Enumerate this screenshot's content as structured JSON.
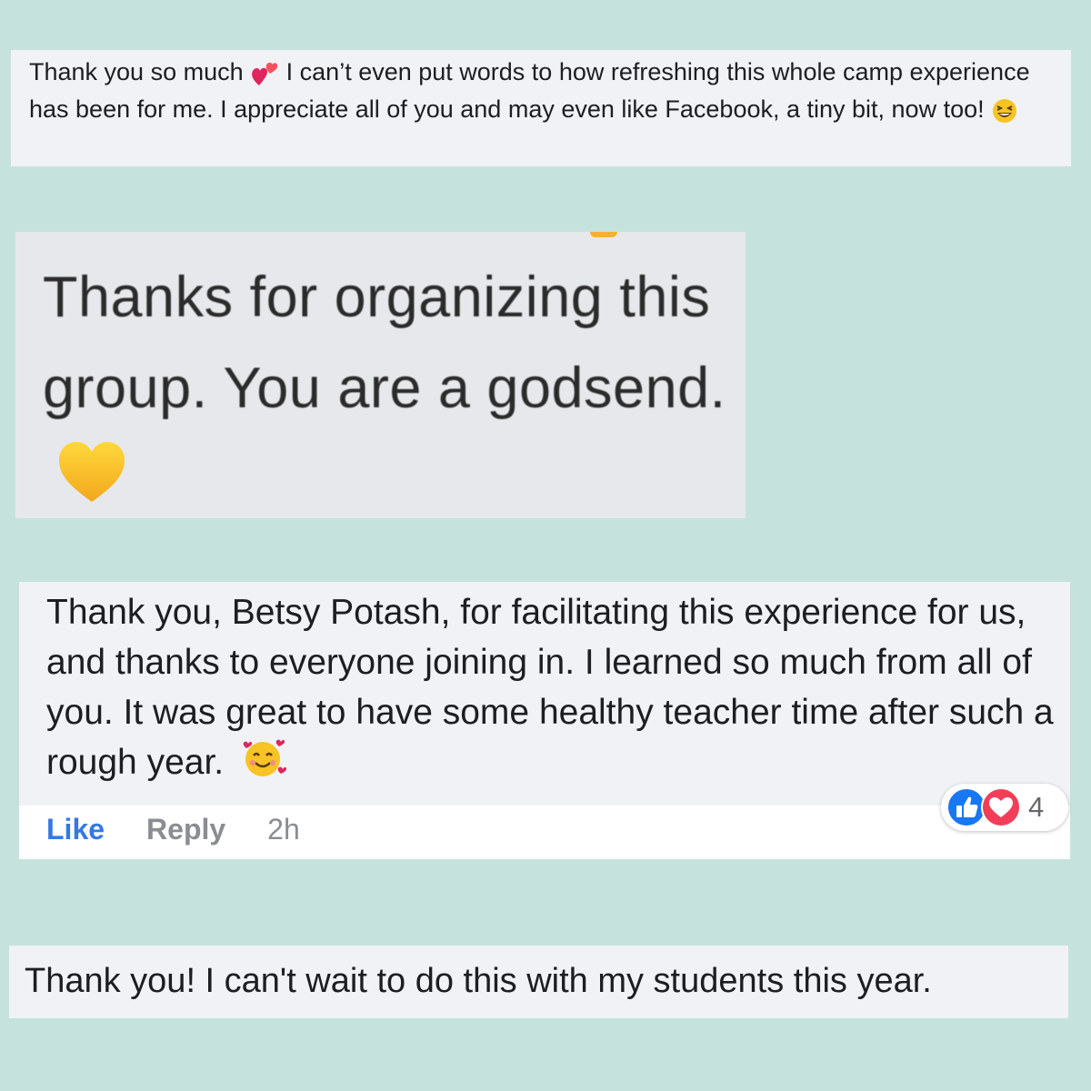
{
  "comments": [
    {
      "text_before": "Thank you so much",
      "emoji_1": "two-hearts-emoji",
      "text_after": " I can’t even put words to how refreshing this whole camp experience has been for me. I appreciate all of you and may even like Facebook, a tiny bit, now too!",
      "emoji_2": "grinning-squinting-face-emoji"
    },
    {
      "text": "Thanks for organizing this group. You are a godsend.",
      "emoji": "yellow-heart-emoji"
    },
    {
      "text": "Thank you, Betsy Potash, for facilitating this experience for us, and thanks to everyone joining in. I learned so much from all of you. It was great to have some healthy teacher time after such a rough year.",
      "emoji": "smiling-face-with-hearts-emoji",
      "actions": {
        "like": "Like",
        "reply": "Reply",
        "time": "2h"
      },
      "reactions": {
        "icons": [
          "like-reaction-icon",
          "love-reaction-icon"
        ],
        "count": "4"
      }
    },
    {
      "text": "Thank you! I can't wait to do this with my students this year."
    }
  ],
  "colors": {
    "background": "#c5e3dc",
    "bubble": "#f0f2f5",
    "like_blue": "#3578e5",
    "love_red": "#f33e58",
    "muted": "#8a8d91"
  }
}
